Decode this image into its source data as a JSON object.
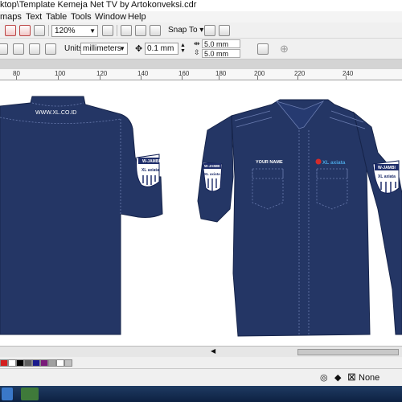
{
  "title": "ktop\\Template Kemeja Net TV by Artokonveksi.cdr",
  "menu": [
    "maps",
    "Text",
    "Table",
    "Tools",
    "Window",
    "Help"
  ],
  "toolbar": {
    "zoom": "120%",
    "snap_label": "Snap To"
  },
  "property_bar": {
    "units_label": "Units:",
    "units_value": "millimeters",
    "nudge_value": "0.1 mm",
    "duplicate_x": "5.0 mm",
    "duplicate_y": "5.0 mm"
  },
  "ruler": {
    "labels": [
      "80",
      "100",
      "120",
      "140",
      "160",
      "180",
      "200",
      "220",
      "240"
    ]
  },
  "artwork": {
    "back_url": "WWW.XL.CO.ID",
    "front_name": "YOUR NAME",
    "front_logo": "XL axiata",
    "sleeve_badge_top": "W-JAMBI",
    "sleeve_badge_brand": "XL axiata",
    "shirt_color": "#243665"
  },
  "palette_colors": [
    "#d41e1e",
    "#ffffff",
    "#000000",
    "#606060",
    "#1a1a8c",
    "#7a1a7a",
    "#a0a0a0",
    "#ffffff",
    "#c0c0c0"
  ],
  "status": {
    "fill_label": "None"
  }
}
